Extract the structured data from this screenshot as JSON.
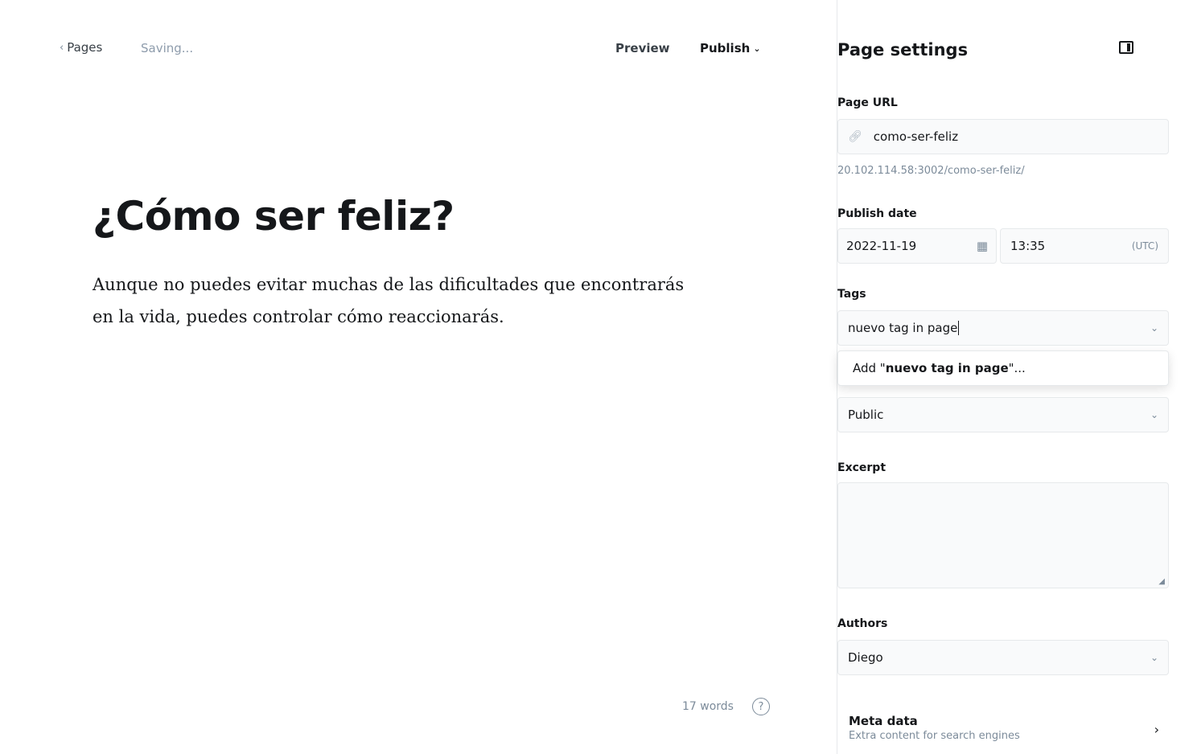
{
  "topbar": {
    "back_label": "Pages",
    "status": "Saving...",
    "preview_label": "Preview",
    "publish_label": "Publish"
  },
  "editor": {
    "title": "¿Cómo ser feliz?",
    "paragraph_line1": "Aunque no puedes evitar muchas de las dificultades que encontrarás",
    "paragraph_line2": "en la vida, puedes controlar cómo reaccionarás.",
    "word_count": "17 words",
    "help_icon": "question-circle-icon"
  },
  "settings": {
    "title": "Page settings",
    "page_url_label": "Page URL",
    "page_url_value": "como-ser-feliz",
    "page_url_hint": "20.102.114.58:3002/como-ser-feliz/",
    "publish_date_label": "Publish date",
    "date_value": "2022-11-19",
    "time_value": "13:35",
    "timezone": "(UTC)",
    "tags_label": "Tags",
    "tags_input_value": "nuevo tag in page",
    "tags_dropdown_prefix": "Add \"",
    "tags_dropdown_bold": "nuevo tag in page",
    "tags_dropdown_suffix": "\"...",
    "visibility_value": "Public",
    "excerpt_label": "Excerpt",
    "authors_label": "Authors",
    "authors_value": "Diego",
    "meta_title": "Meta data",
    "meta_subtitle": "Extra content for search engines"
  }
}
